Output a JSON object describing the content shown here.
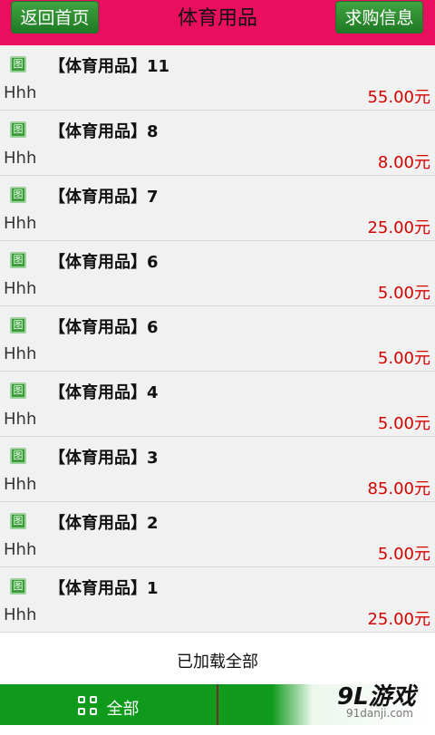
{
  "header": {
    "back_label": "返回首页",
    "title": "体育用品",
    "wanted_label": "求购信息"
  },
  "listing": [
    {
      "icon": "picture-icon",
      "icon_glyph": "图",
      "name": "【体育用品】11",
      "seller": "Hhh",
      "price": "55.00元"
    },
    {
      "icon": "picture-icon",
      "icon_glyph": "图",
      "name": "【体育用品】8",
      "seller": "Hhh",
      "price": "8.00元"
    },
    {
      "icon": "picture-icon",
      "icon_glyph": "图",
      "name": "【体育用品】7",
      "seller": "Hhh",
      "price": "25.00元"
    },
    {
      "icon": "picture-icon",
      "icon_glyph": "图",
      "name": "【体育用品】6",
      "seller": "Hhh",
      "price": "5.00元"
    },
    {
      "icon": "picture-icon",
      "icon_glyph": "图",
      "name": "【体育用品】6",
      "seller": "Hhh",
      "price": "5.00元"
    },
    {
      "icon": "picture-icon",
      "icon_glyph": "图",
      "name": "【体育用品】4",
      "seller": "Hhh",
      "price": "5.00元"
    },
    {
      "icon": "picture-icon",
      "icon_glyph": "图",
      "name": "【体育用品】3",
      "seller": "Hhh",
      "price": "85.00元"
    },
    {
      "icon": "picture-icon",
      "icon_glyph": "图",
      "name": "【体育用品】2",
      "seller": "Hhh",
      "price": "5.00元"
    },
    {
      "icon": "picture-icon",
      "icon_glyph": "图",
      "name": "【体育用品】1",
      "seller": "Hhh",
      "price": "25.00元"
    }
  ],
  "footer": {
    "loaded_text": "已加载全部"
  },
  "tabbar": {
    "all_label": "全部",
    "all_icon": "grid-icon"
  },
  "watermark": {
    "main": "9L游戏",
    "sub": "91danji.com"
  },
  "colors": {
    "header": "#ea0f5e",
    "button": "#2a8a2f",
    "price": "#d40000",
    "tabbar": "#0f9a1b"
  }
}
